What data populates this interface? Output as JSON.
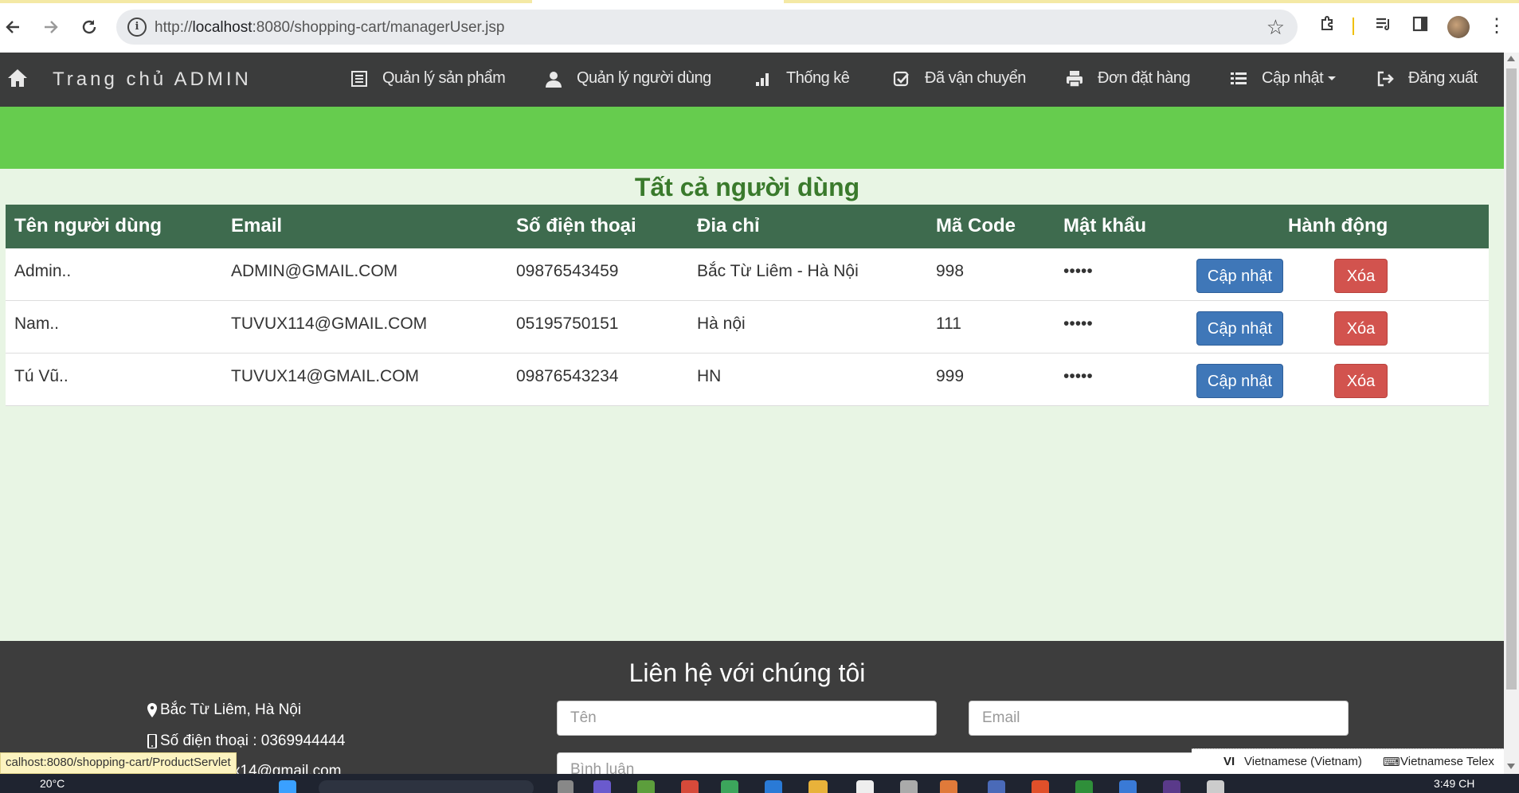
{
  "browser": {
    "url_prefix": "http://",
    "url_host": "localhost",
    "url_rest": ":8080/shopping-cart/managerUser.jsp"
  },
  "nav": {
    "brand": "Trang chủ ADMIN",
    "items": [
      {
        "label": "Quản lý sản phẩm",
        "icon": "list-icon"
      },
      {
        "label": "Quản lý người dùng",
        "icon": "user-icon"
      },
      {
        "label": "Thống kê",
        "icon": "bar-chart-icon"
      },
      {
        "label": "Đã vận chuyển",
        "icon": "check-square-icon"
      },
      {
        "label": "Đơn đặt hàng",
        "icon": "print-icon"
      },
      {
        "label": "Cập nhật",
        "icon": "th-list-icon"
      },
      {
        "label": "Đăng xuất",
        "icon": "logout-icon"
      }
    ]
  },
  "page": {
    "title": "Tất cả người dùng"
  },
  "table": {
    "headers": [
      "Tên người dùng",
      "Email",
      "Số điện thoại",
      "Đia chỉ",
      "Mã Code",
      "Mật khẩu",
      "Hành động"
    ],
    "rows": [
      {
        "name": "Admin..",
        "email": "ADMIN@GMAIL.COM",
        "phone": "09876543459",
        "address": "Bắc Từ Liêm - Hà Nội",
        "code": "998",
        "password": "•••••"
      },
      {
        "name": "Nam..",
        "email": "TUVUX114@GMAIL.COM",
        "phone": "05195750151",
        "address": "Hà nội",
        "code": "111",
        "password": "•••••"
      },
      {
        "name": "Tú Vũ..",
        "email": "TUVUX14@GMAIL.COM",
        "phone": "09876543234",
        "address": "HN",
        "code": "999",
        "password": "•••••"
      }
    ],
    "update_label": "Cập nhật",
    "delete_label": "Xóa"
  },
  "footer": {
    "title": "Liên hệ với chúng tôi",
    "address": "Bắc Từ Liêm, Hà Nội",
    "phone": "Số điện thoại : 0369944444",
    "email_partial": "x14@gmail.com",
    "name_placeholder": "Tên",
    "email_placeholder": "Email",
    "comment_placeholder": "Bình luận"
  },
  "statusbar": {
    "link": "calhost:8080/shopping-cart/ProductServlet"
  },
  "ime": {
    "lang": "VI",
    "lang_label": "Vietnamese (Vietnam)",
    "keyboard": "Vietnamese Telex"
  },
  "taskbar": {
    "weather": "20°C",
    "time": "3:49 CH"
  },
  "colors": {
    "navbar": "#3b3c3c",
    "green_band": "#66cc4e",
    "table_header": "#3e6b4e",
    "title_green": "#3a7a2c",
    "update_btn": "#3f77b8",
    "delete_btn": "#d2534e",
    "footer": "#3d3d3d"
  }
}
